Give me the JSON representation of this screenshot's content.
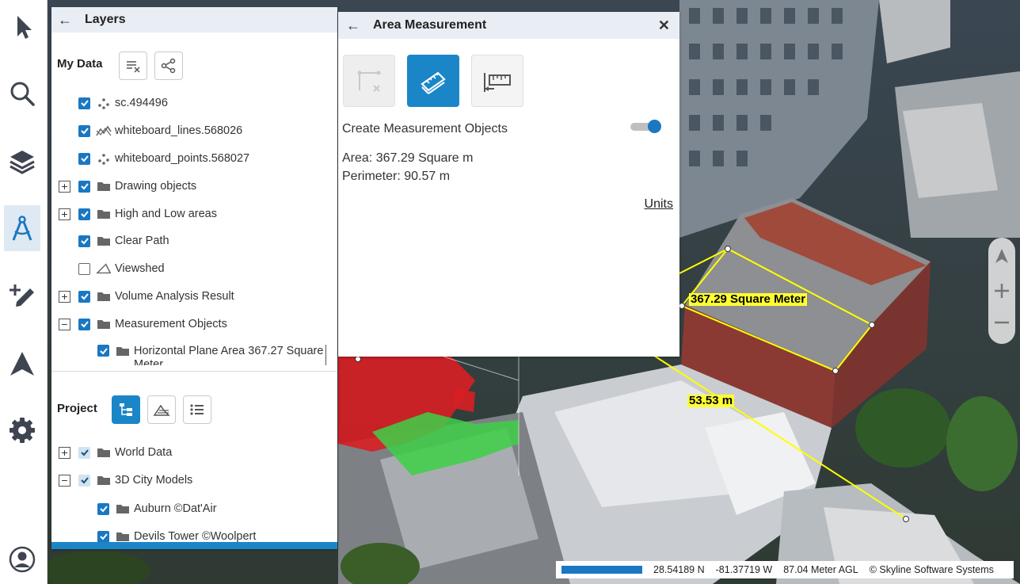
{
  "toolbar": {
    "tools": [
      {
        "name": "select-tool",
        "icon": "cursor-arrow-icon"
      },
      {
        "name": "search-tool",
        "icon": "search-icon"
      },
      {
        "name": "layers-tool",
        "icon": "layers-icon"
      },
      {
        "name": "measure-tool",
        "icon": "compass-icon",
        "active": true
      },
      {
        "name": "draw-tool",
        "icon": "add-pencil-icon"
      },
      {
        "name": "navigate-tool",
        "icon": "navigation-arrow-icon"
      },
      {
        "name": "settings-tool",
        "icon": "gear-icon"
      },
      {
        "name": "user-tool",
        "icon": "user-avatar-icon"
      }
    ]
  },
  "layers_panel": {
    "title": "Layers",
    "my_data": {
      "heading": "My Data",
      "items": [
        {
          "label": "sc.494496",
          "checked": true,
          "icon": "points-icon"
        },
        {
          "label": "whiteboard_lines.568026",
          "checked": true,
          "icon": "lines-icon"
        },
        {
          "label": "whiteboard_points.568027",
          "checked": true,
          "icon": "points-icon"
        },
        {
          "label": "Drawing objects",
          "checked": true,
          "icon": "folder-icon",
          "expander": "+"
        },
        {
          "label": "High and Low areas",
          "checked": true,
          "icon": "folder-icon",
          "expander": "+"
        },
        {
          "label": "Clear Path",
          "checked": true,
          "icon": "folder-icon"
        },
        {
          "label": "Viewshed",
          "checked": false,
          "icon": "viewshed-icon"
        },
        {
          "label": "Volume Analysis Result",
          "checked": true,
          "icon": "folder-icon",
          "expander": "+"
        },
        {
          "label": "Measurement Objects",
          "checked": true,
          "icon": "folder-icon",
          "expander": "−"
        }
      ],
      "child_item": {
        "label_line1": "Horizontal Plane Area 367.27 Square",
        "label_line2": "Meter",
        "checked": true
      }
    },
    "project": {
      "heading": "Project",
      "items": [
        {
          "label": "World Data",
          "checked": "partial",
          "expander": "+"
        },
        {
          "label": "3D City Models",
          "checked": "partial",
          "expander": "−"
        }
      ],
      "children": [
        {
          "label": "Auburn ©Dat'Air",
          "checked": true
        },
        {
          "label": "Devils Tower ©Woolpert",
          "checked": true
        }
      ]
    }
  },
  "measure_panel": {
    "title": "Area Measurement",
    "create_label": "Create Measurement Objects",
    "create_enabled": true,
    "area_text": "Area: 367.29 Square m",
    "perimeter_text": "Perimeter: 90.57 m",
    "units_label": "Units"
  },
  "map": {
    "area_label": "367.29 Square Meter",
    "distance_label": "53.53 m",
    "accent_color": "#ffff00"
  },
  "status_bar": {
    "latitude": "28.54189 N",
    "longitude": "-81.37719 W",
    "altitude": "87.04 Meter AGL",
    "attribution": "© Skyline Software Systems"
  },
  "colors": {
    "accent": "#1a86c8",
    "active_tool_bg": "#dfe9f3",
    "panel_header": "#e9eef5"
  }
}
